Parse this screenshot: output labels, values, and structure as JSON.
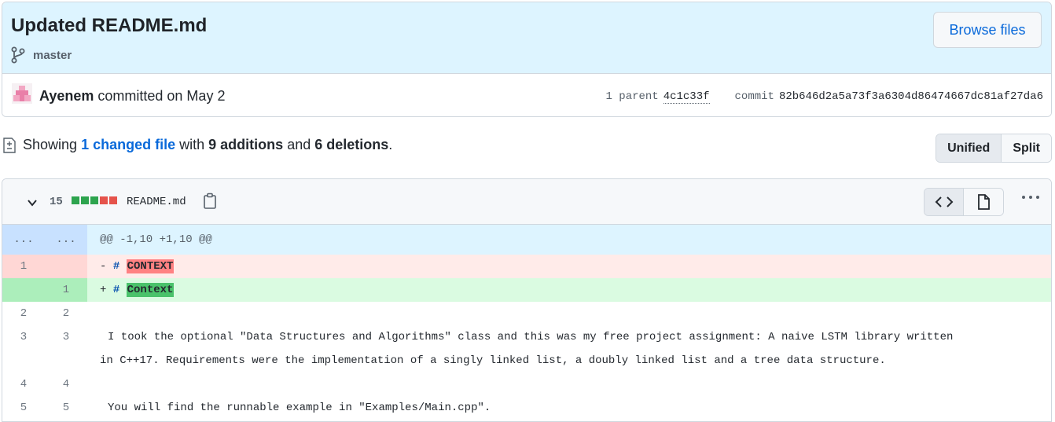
{
  "commit": {
    "title": "Updated README.md",
    "branch": "master",
    "browse_label": "Browse files",
    "author": "Ayenem",
    "action": "committed on May 2",
    "parent_label": "1 parent",
    "parent_sha": "4c1c33f",
    "commit_label": "commit",
    "commit_sha": "82b646d2a5a73f3a6304d86474667dc81af27da6"
  },
  "summary": {
    "prefix": "Showing",
    "changed": "1 changed file",
    "with": "with",
    "additions": "9 additions",
    "and": "and",
    "deletions": "6 deletions",
    "suffix": "."
  },
  "view_toggle": {
    "unified": "Unified",
    "split": "Split"
  },
  "file": {
    "change_count": "15",
    "name": "README.md"
  },
  "diff": {
    "hunk": {
      "left": "...",
      "right": "...",
      "text": "@@ -1,10 +1,10 @@"
    },
    "lines": [
      {
        "type": "del",
        "old": "1",
        "new": "",
        "sign": "-",
        "hash": "#",
        "word": "CONTEXT"
      },
      {
        "type": "add",
        "old": "",
        "new": "1",
        "sign": "+",
        "hash": "#",
        "word": "Context"
      },
      {
        "type": "ctx",
        "old": "2",
        "new": "2",
        "text": ""
      },
      {
        "type": "ctx",
        "old": "3",
        "new": "3",
        "text": "I took the optional \"Data Structures and Algorithms\" class and this was my free project assignment: A naive LSTM library written\nin C++17. Requirements were the implementation of a singly linked list, a doubly linked list and a tree data structure."
      },
      {
        "type": "ctx",
        "old": "4",
        "new": "4",
        "text": ""
      },
      {
        "type": "ctx",
        "old": "5",
        "new": "5",
        "text": "You will find the runnable example in \"Examples/Main.cpp\"."
      }
    ]
  },
  "colors": {
    "accent": "#0969da",
    "addition": "#2da44e",
    "deletion": "#e5534b"
  },
  "icons": [
    "branch-icon",
    "avatar",
    "file-diff-icon",
    "chevron-down-icon",
    "copy-icon",
    "code-icon",
    "file-icon",
    "kebab-icon"
  ]
}
